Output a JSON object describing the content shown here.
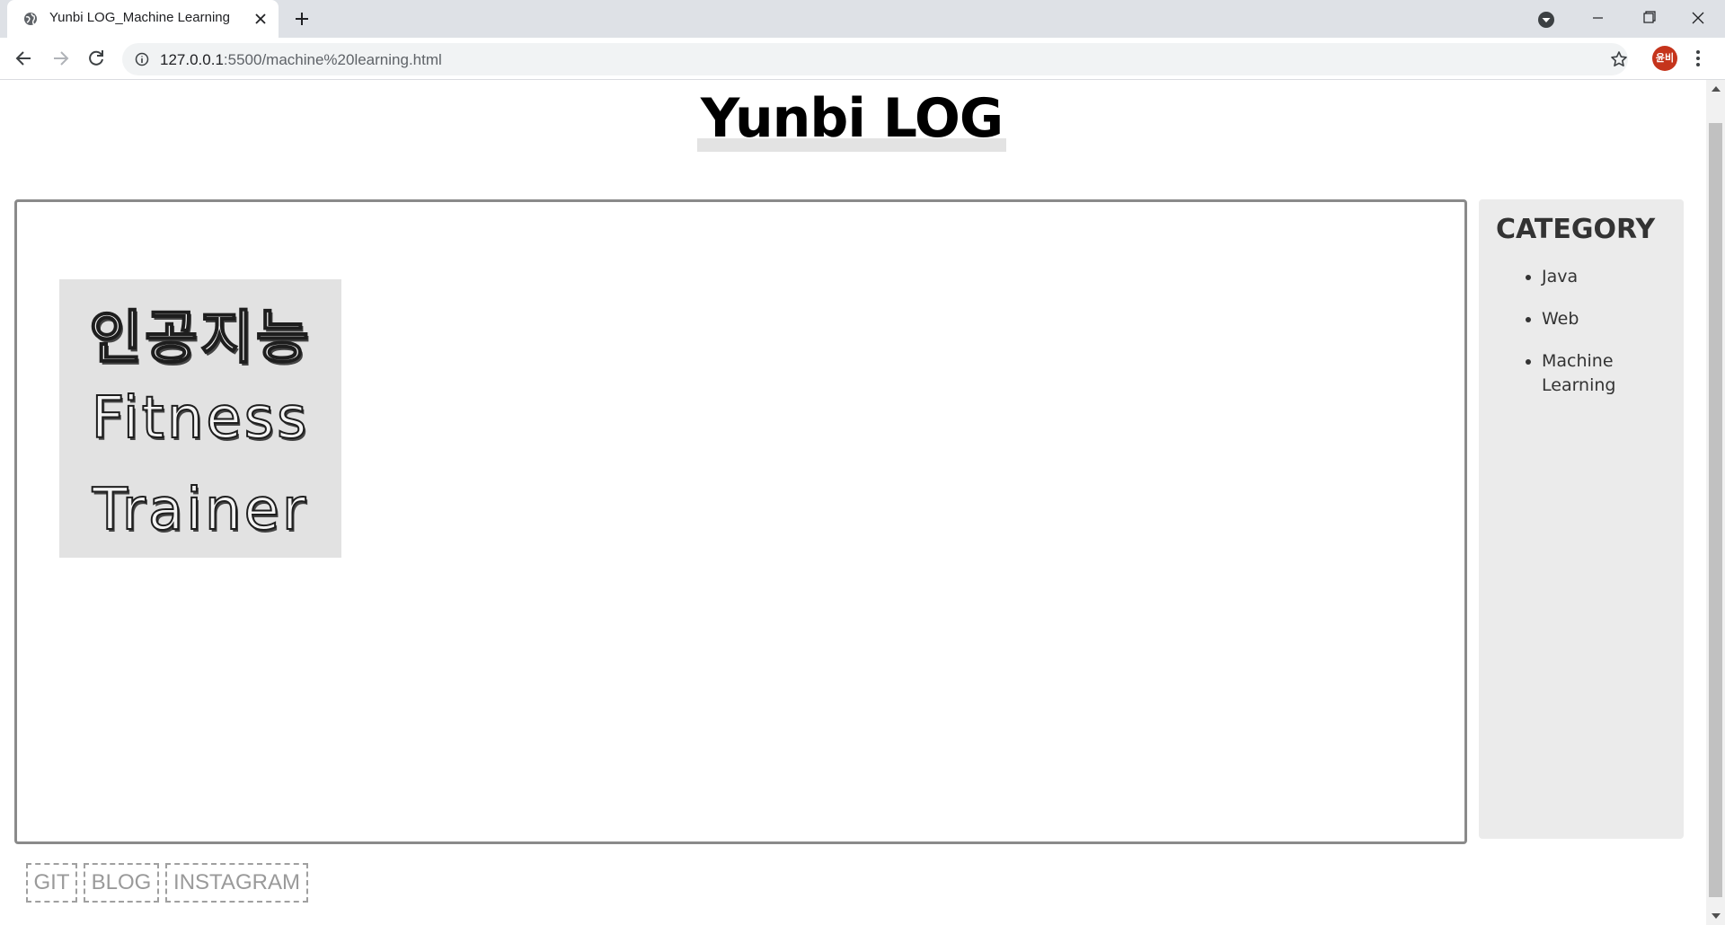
{
  "browser": {
    "tab_title": "Yunbi LOG_Machine Learning",
    "url_host": "127.0.0.1",
    "url_rest": ":5500/machine%20learning.html",
    "avatar_label": "윤비"
  },
  "site": {
    "title": "Yunbi LOG"
  },
  "post": {
    "thumbnail_lines": [
      "인공지능",
      "Fitness",
      "Trainer"
    ]
  },
  "sidebar": {
    "heading": "CATEGORY",
    "items": [
      {
        "label": "Java"
      },
      {
        "label": "Web"
      },
      {
        "label": "Machine Learning"
      }
    ]
  },
  "footer_links": [
    {
      "label": "GIT"
    },
    {
      "label": "BLOG"
    },
    {
      "label": "INSTAGRAM"
    }
  ],
  "colors": {
    "tabbar_bg": "#dee1e6",
    "avatar_bg": "#c5341c",
    "sidebar_bg": "#ebebeb",
    "main_border": "#8a8a8a",
    "link_text": "#9a9a9a"
  }
}
